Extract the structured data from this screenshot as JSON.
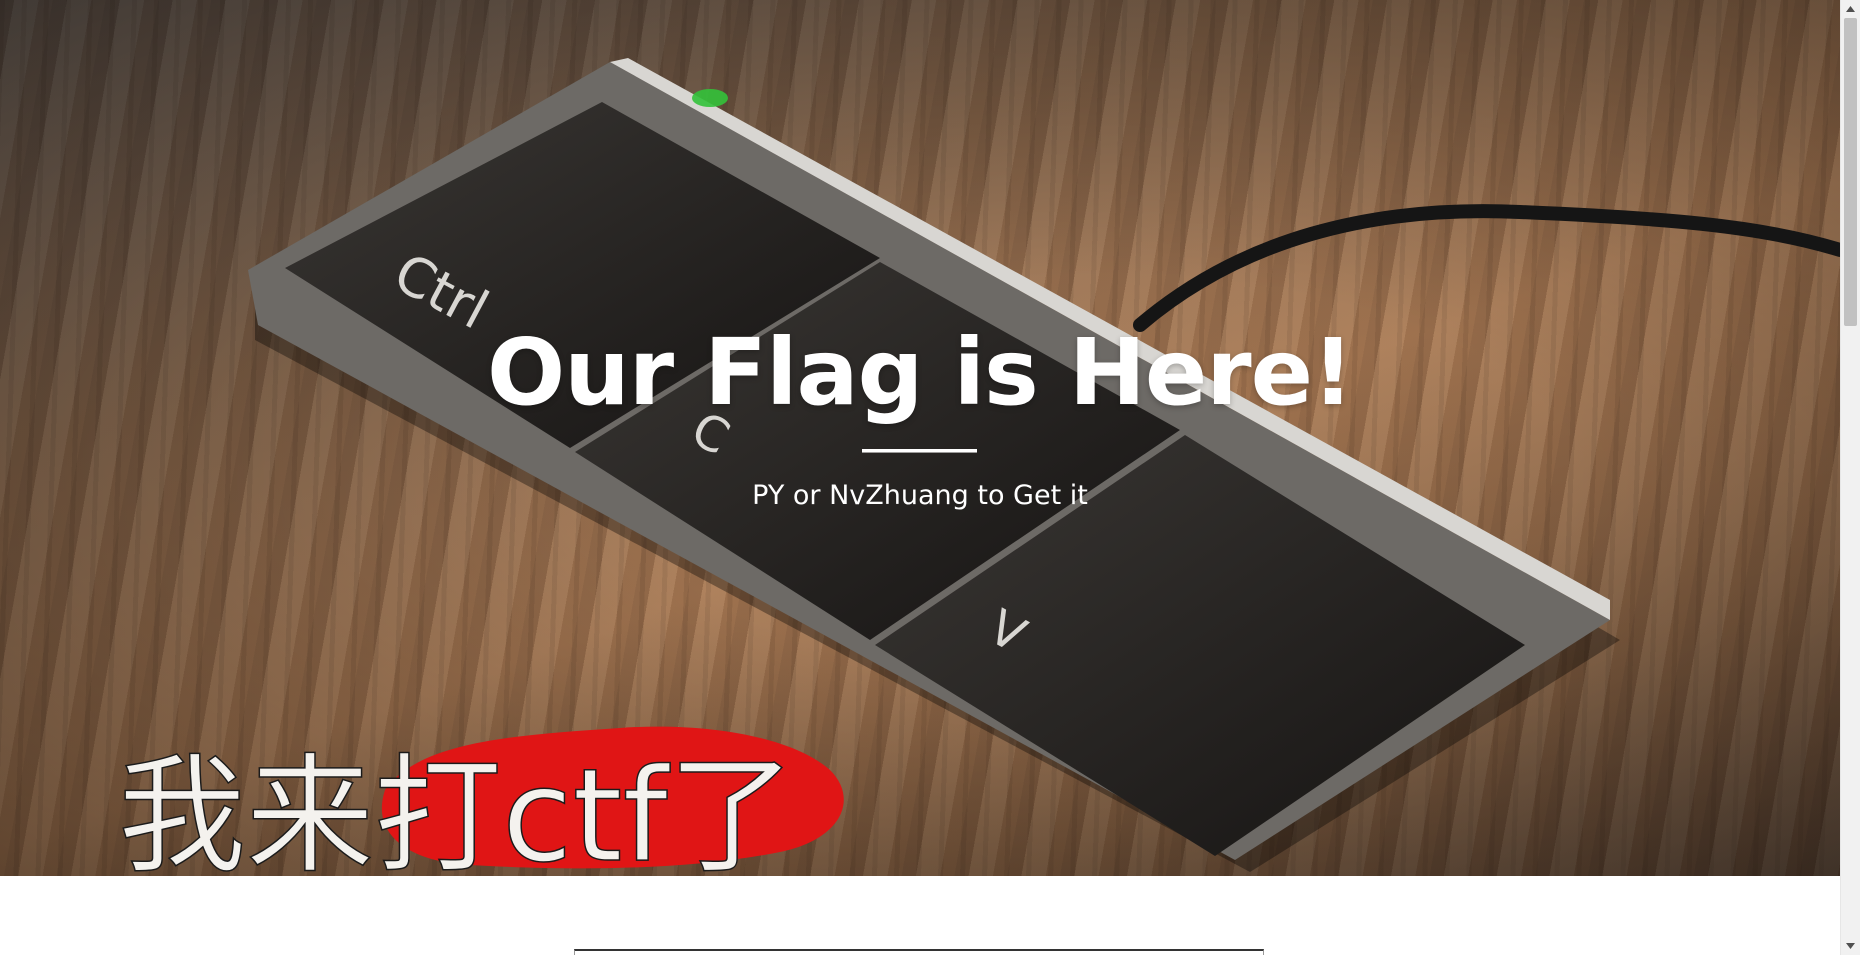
{
  "hero": {
    "title": "Our Flag is Here!",
    "subtitle": "PY or NvZhuang to Get it"
  },
  "photo": {
    "key_labels": [
      "Ctrl",
      "C",
      "V"
    ],
    "caption_prefix": "我来",
    "caption_highlight": "打ctf",
    "caption_suffix": "了"
  },
  "icons": {
    "scroll_up": "triangle-up-icon",
    "scroll_down": "triangle-down-icon"
  },
  "colors": {
    "text": "#ffffff",
    "highlight": "#e01515",
    "scrollbar_thumb": "#c1c1c1"
  }
}
